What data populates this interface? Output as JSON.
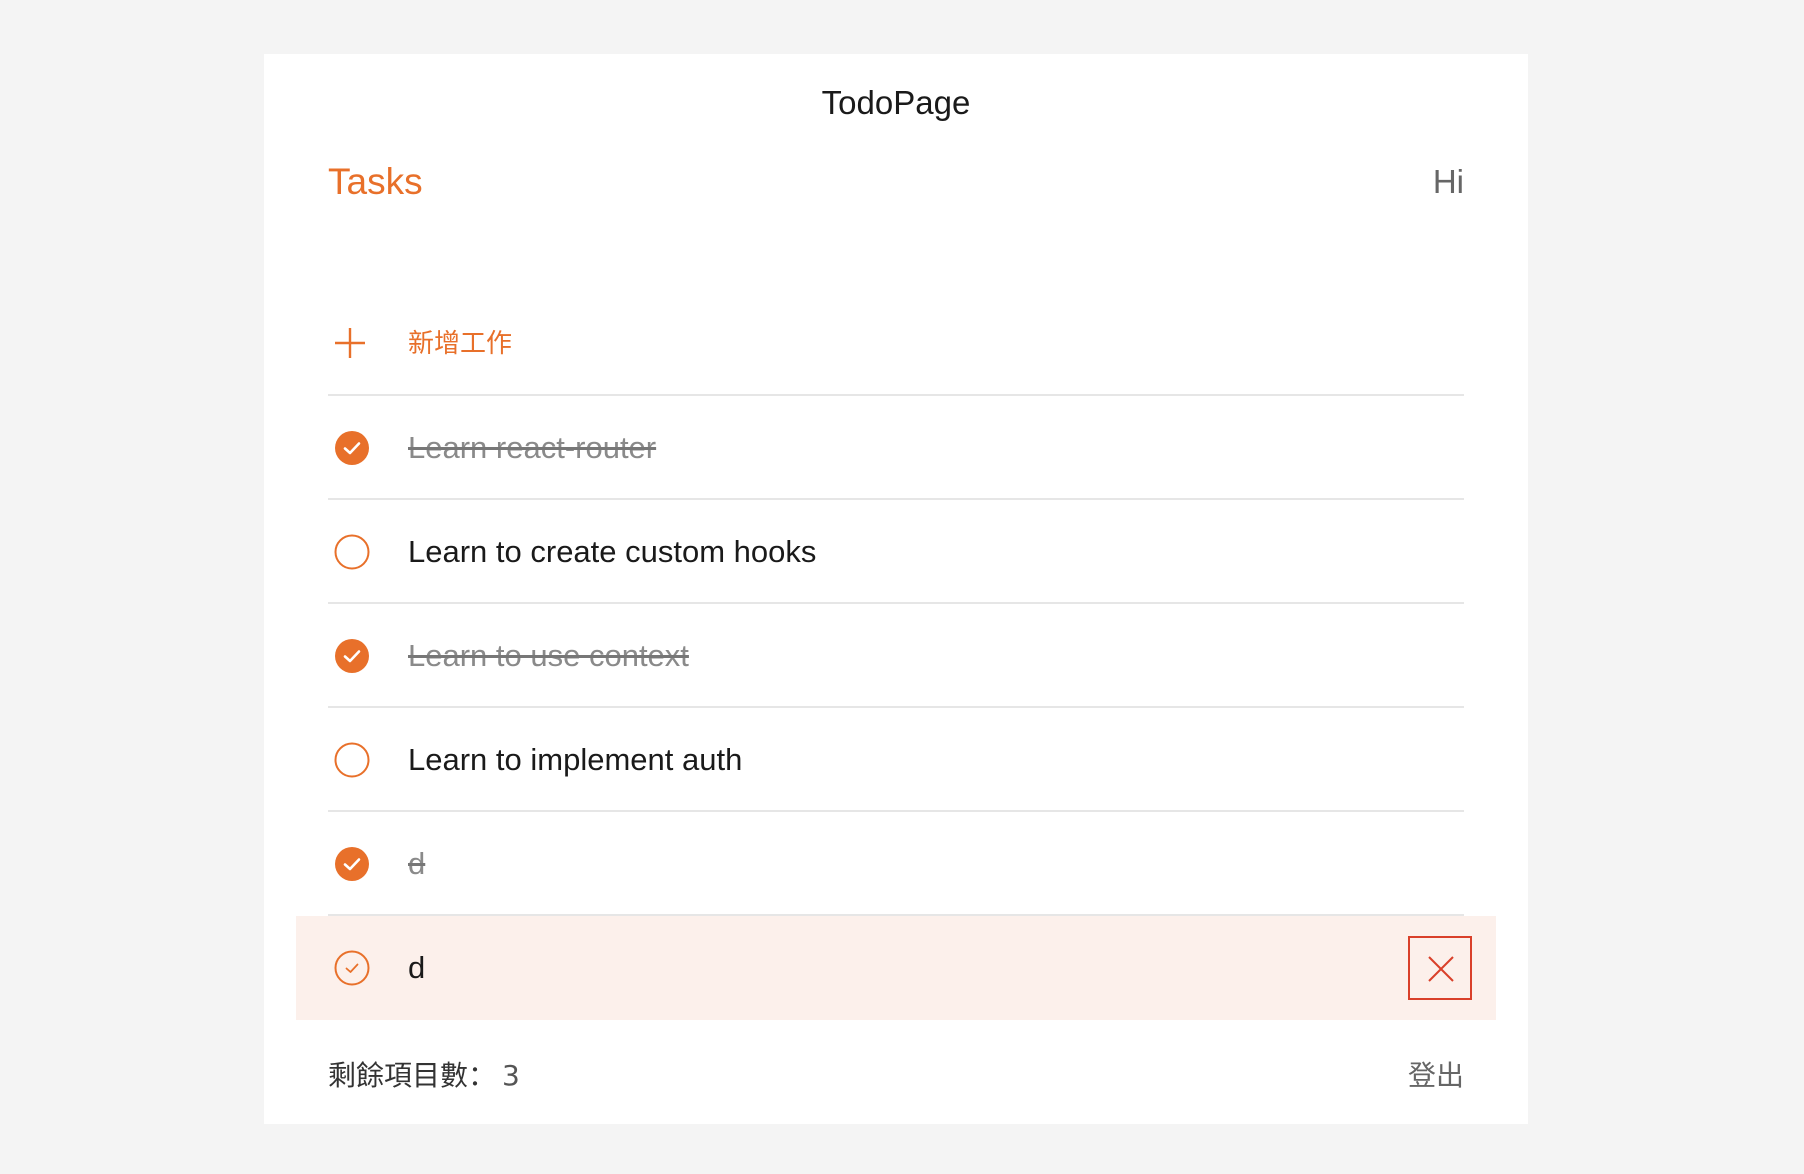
{
  "app": {
    "title": "TodoPage"
  },
  "header": {
    "tasks_label": "Tasks",
    "greeting": "Hi"
  },
  "add_task": {
    "label": "新增工作",
    "icon": "plus-icon"
  },
  "tasks": [
    {
      "text": "Learn react-router",
      "completed": true
    },
    {
      "text": "Learn to create custom hooks",
      "completed": false
    },
    {
      "text": "Learn to use context",
      "completed": true
    },
    {
      "text": "Learn to implement auth",
      "completed": false
    },
    {
      "text": "d",
      "completed": true
    },
    {
      "text": "d",
      "completed": false,
      "hovered": true
    }
  ],
  "footer": {
    "remaining_label": "剩餘項目數：",
    "remaining_count": "3",
    "logout_label": "登出"
  },
  "colors": {
    "accent": "#e8702a",
    "delete": "#d9402a",
    "hover_bg": "#fcf0eb",
    "page_bg": "#f4f4f4"
  }
}
